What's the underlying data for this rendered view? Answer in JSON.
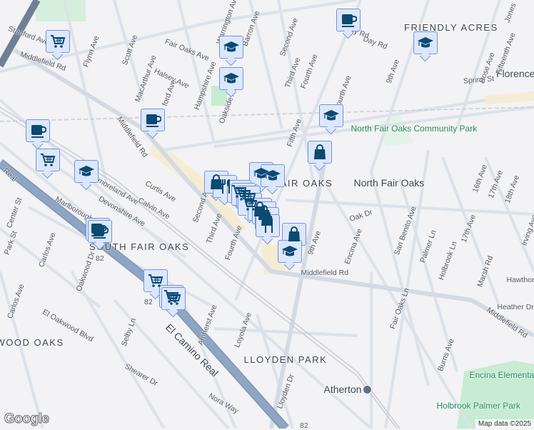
{
  "map": {
    "colors": {
      "background": "#f3f2f4",
      "road": "#dde3ec",
      "highway": "#8ea5c4",
      "marker_fill": "#dce7fc",
      "marker_border": "#6f96dd",
      "icon": "#0b4a73",
      "park": "#c8ebd3"
    },
    "labels": [
      "FRIENDLY ACRES",
      "Fair Oaks Ave",
      "Warrington Ave",
      "Barron Ave",
      "Second Ave",
      "Third Ave",
      "Fourth Ave",
      "Scott Ave",
      "Flynn Ave",
      "Halsey Ave",
      "MacArthur Ave",
      "Hampshire Ave",
      "Oakside Ave",
      "Middlefield Rd",
      "Middlefield Rd",
      "Fifth Ave",
      "Spring St",
      "Florence",
      "Rose Ave",
      "Fifteenth Ave",
      "9th Ave",
      "Fourth Ave",
      "North Fair Oaks Community Park",
      "North Fair Oaks",
      "FAIR OAKS",
      "Oak Dr",
      "16th Ave",
      "17th Ave",
      "18th Ave",
      "Irving Ave",
      "Encina Ave",
      "San Benito Ave",
      "Palmer Ln",
      "Holbrook Ln",
      "17th Ave",
      "Marsh Rd",
      "Hawthorn",
      "Heather Dr",
      "Middlefield Rd",
      "Middlefield Rd",
      "Fair Oaks Ln",
      "Burns Ave",
      "Atherton",
      "Holbrook Palmer Park",
      "Encina Elementary Sch",
      "LLOYDEN PARK",
      "Loyola Ave",
      "Amherst Ave",
      "Lloyden Dr",
      "Nora Way",
      "Shearer Dr",
      "Selby Ln",
      "El Camino Real",
      "WOOD OAKS",
      "El Oakwood Blvd",
      "Oakwood Dr",
      "Carlos Ave",
      "Carlos Ave",
      "Park St",
      "Center St",
      "SOUTH FAIR OAKS",
      "Marlborough Ave",
      "Devonshire Ave",
      "Westmoreland Ave",
      "Calvin Ave",
      "Curtis Ave",
      "Second Ave",
      "Third Ave",
      "Fourth Ave",
      "9th Ave",
      "Real",
      "Stanford Ave",
      "Jones",
      "Day Rd",
      "Bay Rd",
      "ford Ave",
      "82",
      "82",
      "82"
    ],
    "markers": [
      "cart",
      "education",
      "education",
      "coffee",
      "education",
      "coffee",
      "coffee",
      "cart",
      "education",
      "education",
      "bag",
      "education",
      "education",
      "bag",
      "restaurant",
      "cart",
      "cart",
      "cart",
      "cart",
      "bag",
      "bag",
      "bag",
      "restaurant",
      "bag",
      "education",
      "coffee",
      "coffee",
      "cart",
      "cart",
      "cart"
    ],
    "logo": "Google",
    "attribution": "Map data ©2025"
  }
}
